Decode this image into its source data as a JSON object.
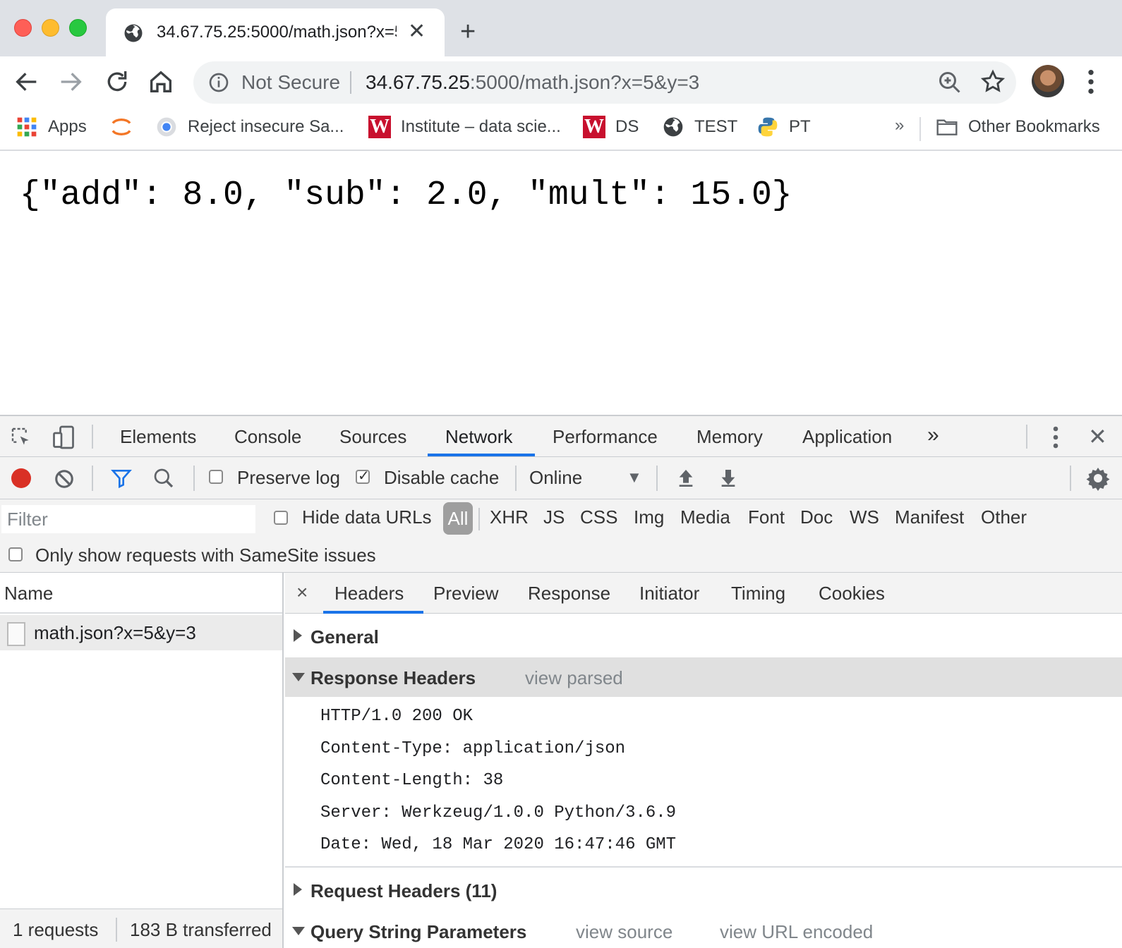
{
  "tab": {
    "title": "34.67.75.25:5000/math.json?x=5&y=3"
  },
  "omnibox": {
    "security": "Not Secure",
    "host": "34.67.75.25",
    "rest": ":5000/math.json?x=5&y=3"
  },
  "bookmarks": {
    "items": [
      "Apps",
      "Reject insecure Sa...",
      "Institute – data scie...",
      "DS",
      "TEST",
      "PT"
    ],
    "overflow": "»",
    "other": "Other Bookmarks"
  },
  "page": {
    "json_text": "{\"add\": 8.0, \"sub\": 2.0, \"mult\": 15.0}"
  },
  "devtools": {
    "tabs": [
      "Elements",
      "Console",
      "Sources",
      "Network",
      "Performance",
      "Memory",
      "Application"
    ],
    "active_tab": "Network",
    "more": "»",
    "network_toolbar": {
      "preserve_log": "Preserve log",
      "disable_cache": "Disable cache",
      "throttle": "Online"
    },
    "filter": {
      "placeholder": "Filter",
      "hide_data_urls": "Hide data URLs",
      "types": [
        "All",
        "XHR",
        "JS",
        "CSS",
        "Img",
        "Media",
        "Font",
        "Doc",
        "WS",
        "Manifest",
        "Other"
      ],
      "samesite": "Only show requests with SameSite issues"
    },
    "requests": {
      "column": "Name",
      "rows": [
        "math.json?x=5&y=3"
      ],
      "count": "1 requests",
      "transferred": "183 B transferred"
    },
    "detail": {
      "close": "×",
      "tabs": [
        "Headers",
        "Preview",
        "Response",
        "Initiator",
        "Timing",
        "Cookies"
      ],
      "active_tab": "Headers",
      "general": "General",
      "response_headers": {
        "title": "Response Headers",
        "link": "view parsed",
        "lines": [
          "HTTP/1.0 200 OK",
          "Content-Type: application/json",
          "Content-Length: 38",
          "Server: Werkzeug/1.0.0 Python/3.6.9",
          "Date: Wed, 18 Mar 2020 16:47:46 GMT"
        ]
      },
      "request_headers": "Request Headers (11)",
      "query_params": {
        "title": "Query String Parameters",
        "view_source": "view source",
        "view_url_encoded": "view URL encoded"
      }
    }
  }
}
